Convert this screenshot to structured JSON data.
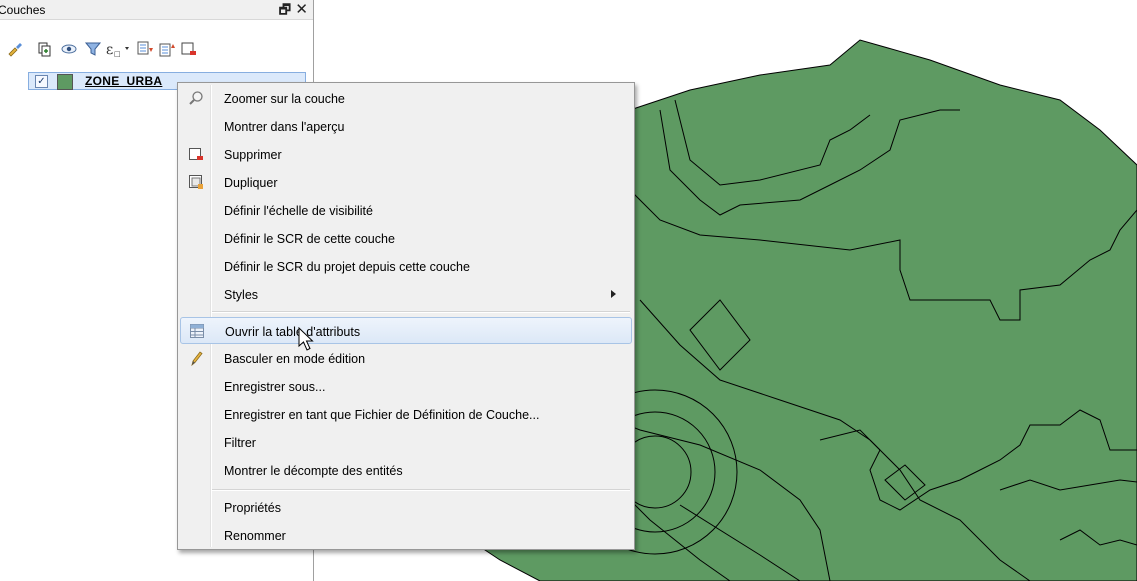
{
  "panel": {
    "title": "Couches",
    "float_glyph": "🗗",
    "close_glyph": "✕"
  },
  "toolbar": {
    "icons": [
      "style-brush-icon",
      "add-group-icon",
      "eye-visibility-icon",
      "filter-icon",
      "expression-filter-icon",
      "expand-all-icon",
      "collapse-all-icon",
      "remove-layer-icon"
    ]
  },
  "layer": {
    "name": "ZONE_URBA",
    "checked": true,
    "fill_color": "#5e9a62"
  },
  "map": {
    "polygon_fill": "#5e9a62",
    "stroke": "#000000"
  },
  "context_menu": {
    "items": [
      {
        "label": "Zoomer sur la couche",
        "icon": "zoom-icon"
      },
      {
        "label": "Montrer dans l'aperçu",
        "icon": ""
      },
      {
        "label": "Supprimer",
        "icon": "remove-icon"
      },
      {
        "label": "Dupliquer",
        "icon": "duplicate-icon"
      },
      {
        "label": "Définir l'échelle de visibilité",
        "icon": ""
      },
      {
        "label": "Définir le SCR de cette couche",
        "icon": ""
      },
      {
        "label": "Définir le SCR du projet depuis cette couche",
        "icon": ""
      },
      {
        "label": "Styles",
        "icon": "",
        "submenu": true
      },
      {
        "label": "Ouvrir la table d'attributs",
        "icon": "attribute-table-icon",
        "hover": true
      },
      {
        "label": "Basculer en mode édition",
        "icon": "pencil-icon"
      },
      {
        "label": "Enregistrer sous...",
        "icon": ""
      },
      {
        "label": "Enregistrer en tant que Fichier de Définition de Couche...",
        "icon": ""
      },
      {
        "label": "Filtrer",
        "icon": ""
      },
      {
        "label": "Montrer le décompte des entités",
        "icon": ""
      },
      {
        "label": "Propriétés",
        "icon": ""
      },
      {
        "label": "Renommer",
        "icon": ""
      }
    ]
  }
}
